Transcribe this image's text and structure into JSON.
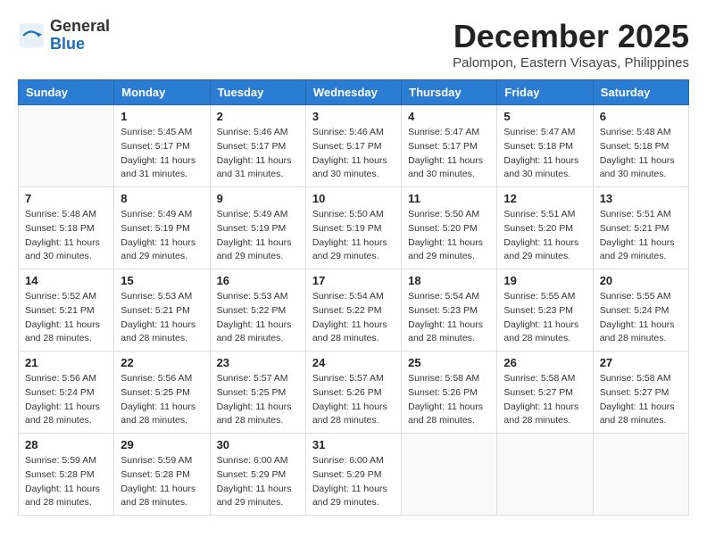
{
  "header": {
    "logo_general": "General",
    "logo_blue": "Blue",
    "month": "December 2025",
    "location": "Palompon, Eastern Visayas, Philippines"
  },
  "calendar": {
    "days_of_week": [
      "Sunday",
      "Monday",
      "Tuesday",
      "Wednesday",
      "Thursday",
      "Friday",
      "Saturday"
    ],
    "weeks": [
      [
        {
          "day": "",
          "info": ""
        },
        {
          "day": "1",
          "info": "Sunrise: 5:45 AM\nSunset: 5:17 PM\nDaylight: 11 hours\nand 31 minutes."
        },
        {
          "day": "2",
          "info": "Sunrise: 5:46 AM\nSunset: 5:17 PM\nDaylight: 11 hours\nand 31 minutes."
        },
        {
          "day": "3",
          "info": "Sunrise: 5:46 AM\nSunset: 5:17 PM\nDaylight: 11 hours\nand 30 minutes."
        },
        {
          "day": "4",
          "info": "Sunrise: 5:47 AM\nSunset: 5:17 PM\nDaylight: 11 hours\nand 30 minutes."
        },
        {
          "day": "5",
          "info": "Sunrise: 5:47 AM\nSunset: 5:18 PM\nDaylight: 11 hours\nand 30 minutes."
        },
        {
          "day": "6",
          "info": "Sunrise: 5:48 AM\nSunset: 5:18 PM\nDaylight: 11 hours\nand 30 minutes."
        }
      ],
      [
        {
          "day": "7",
          "info": "Sunrise: 5:48 AM\nSunset: 5:18 PM\nDaylight: 11 hours\nand 30 minutes."
        },
        {
          "day": "8",
          "info": "Sunrise: 5:49 AM\nSunset: 5:19 PM\nDaylight: 11 hours\nand 29 minutes."
        },
        {
          "day": "9",
          "info": "Sunrise: 5:49 AM\nSunset: 5:19 PM\nDaylight: 11 hours\nand 29 minutes."
        },
        {
          "day": "10",
          "info": "Sunrise: 5:50 AM\nSunset: 5:19 PM\nDaylight: 11 hours\nand 29 minutes."
        },
        {
          "day": "11",
          "info": "Sunrise: 5:50 AM\nSunset: 5:20 PM\nDaylight: 11 hours\nand 29 minutes."
        },
        {
          "day": "12",
          "info": "Sunrise: 5:51 AM\nSunset: 5:20 PM\nDaylight: 11 hours\nand 29 minutes."
        },
        {
          "day": "13",
          "info": "Sunrise: 5:51 AM\nSunset: 5:21 PM\nDaylight: 11 hours\nand 29 minutes."
        }
      ],
      [
        {
          "day": "14",
          "info": "Sunrise: 5:52 AM\nSunset: 5:21 PM\nDaylight: 11 hours\nand 28 minutes."
        },
        {
          "day": "15",
          "info": "Sunrise: 5:53 AM\nSunset: 5:21 PM\nDaylight: 11 hours\nand 28 minutes."
        },
        {
          "day": "16",
          "info": "Sunrise: 5:53 AM\nSunset: 5:22 PM\nDaylight: 11 hours\nand 28 minutes."
        },
        {
          "day": "17",
          "info": "Sunrise: 5:54 AM\nSunset: 5:22 PM\nDaylight: 11 hours\nand 28 minutes."
        },
        {
          "day": "18",
          "info": "Sunrise: 5:54 AM\nSunset: 5:23 PM\nDaylight: 11 hours\nand 28 minutes."
        },
        {
          "day": "19",
          "info": "Sunrise: 5:55 AM\nSunset: 5:23 PM\nDaylight: 11 hours\nand 28 minutes."
        },
        {
          "day": "20",
          "info": "Sunrise: 5:55 AM\nSunset: 5:24 PM\nDaylight: 11 hours\nand 28 minutes."
        }
      ],
      [
        {
          "day": "21",
          "info": "Sunrise: 5:56 AM\nSunset: 5:24 PM\nDaylight: 11 hours\nand 28 minutes."
        },
        {
          "day": "22",
          "info": "Sunrise: 5:56 AM\nSunset: 5:25 PM\nDaylight: 11 hours\nand 28 minutes."
        },
        {
          "day": "23",
          "info": "Sunrise: 5:57 AM\nSunset: 5:25 PM\nDaylight: 11 hours\nand 28 minutes."
        },
        {
          "day": "24",
          "info": "Sunrise: 5:57 AM\nSunset: 5:26 PM\nDaylight: 11 hours\nand 28 minutes."
        },
        {
          "day": "25",
          "info": "Sunrise: 5:58 AM\nSunset: 5:26 PM\nDaylight: 11 hours\nand 28 minutes."
        },
        {
          "day": "26",
          "info": "Sunrise: 5:58 AM\nSunset: 5:27 PM\nDaylight: 11 hours\nand 28 minutes."
        },
        {
          "day": "27",
          "info": "Sunrise: 5:58 AM\nSunset: 5:27 PM\nDaylight: 11 hours\nand 28 minutes."
        }
      ],
      [
        {
          "day": "28",
          "info": "Sunrise: 5:59 AM\nSunset: 5:28 PM\nDaylight: 11 hours\nand 28 minutes."
        },
        {
          "day": "29",
          "info": "Sunrise: 5:59 AM\nSunset: 5:28 PM\nDaylight: 11 hours\nand 28 minutes."
        },
        {
          "day": "30",
          "info": "Sunrise: 6:00 AM\nSunset: 5:29 PM\nDaylight: 11 hours\nand 29 minutes."
        },
        {
          "day": "31",
          "info": "Sunrise: 6:00 AM\nSunset: 5:29 PM\nDaylight: 11 hours\nand 29 minutes."
        },
        {
          "day": "",
          "info": ""
        },
        {
          "day": "",
          "info": ""
        },
        {
          "day": "",
          "info": ""
        }
      ]
    ]
  }
}
